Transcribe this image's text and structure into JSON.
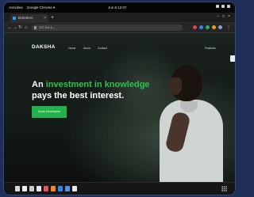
{
  "os_topbar": {
    "activities_label": "Activities",
    "app_label": "Google Chrome ▾",
    "clock": "Jun 6  12:07"
  },
  "browser": {
    "tab_title": "DAKSHA",
    "new_tab_glyph": "+",
    "url": "127.0.0.1:...",
    "colors": {
      "tab_favicon": "#2aa3ff"
    }
  },
  "page": {
    "logo": "DAKSHA",
    "nav_links": [
      "Home",
      "About",
      "Contact"
    ],
    "right_link": "Features",
    "headline_white": "An ",
    "headline_accent": "investment in knowledge",
    "headline_line2": "pays the best interest.",
    "cta_label": "Know Developers",
    "colors": {
      "accent": "#2fc04f",
      "cta": "#22b14c"
    }
  },
  "icons": {
    "back": "arrow-left-icon",
    "forward": "arrow-right-icon",
    "reload": "reload-icon",
    "home": "home-icon",
    "menu": "kebab-menu-icon",
    "apps": "app-grid-icon"
  }
}
